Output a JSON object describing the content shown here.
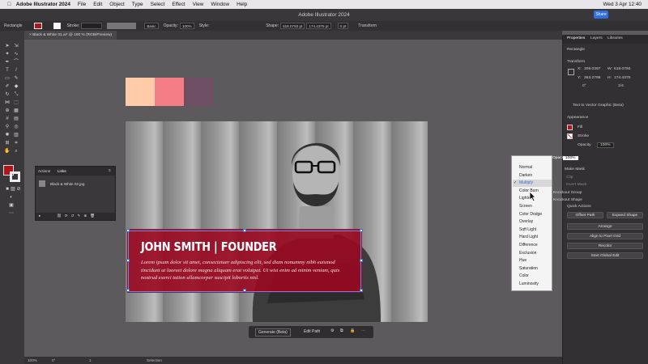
{
  "menubar": {
    "app": "Adobe Illustrator 2024",
    "items": [
      "File",
      "Edit",
      "Object",
      "Type",
      "Select",
      "Effect",
      "View",
      "Window",
      "Help"
    ],
    "share": "Share",
    "datetime": "Wed 3 Apr  12:40"
  },
  "titlebar": {
    "title": "Adobe Illustrator 2024"
  },
  "controlbar": {
    "selection": "Rectangle",
    "stroke_label": "Stroke:",
    "brush": "Basic",
    "opacity_label": "Opacity:",
    "opacity": "100%",
    "style_label": "Style:",
    "shape_label": "Shape:",
    "w": "618.0793 pt",
    "h": "174.4375 pt",
    "corner": "0 pt",
    "transform": "Transform"
  },
  "doc": {
    "tab": "Black & White 01.ai* @ 100 % (RGB/Preview)"
  },
  "swatches": [
    "#ffcba9",
    "#f57d86",
    "#6e4e63"
  ],
  "banner": {
    "title": "JOHN SMITH | FOUNDER",
    "body": "Lorem ipsum dolor sit amet, consectetuer adipiscing elit, sed diam nonummy nibh euismod tincidunt ut laoreet dolore magna aliquam erat volutpat. Ut wisi enim ad minim veniam, quis nostrud exerci tation ullamcorper suscipit lobortis nisl."
  },
  "links": {
    "tab_actions": "Actions",
    "tab_links": "Links",
    "file": "Black & White 02.jpg"
  },
  "props": {
    "tabs": [
      "Properties",
      "Layers",
      "Libraries"
    ],
    "type": "Rectangle",
    "transform": "Transform",
    "x": "309.0397",
    "y": "363.2788",
    "w": "618.0793",
    "h": "174.4375",
    "angle": "0°",
    "ratio": "1/4",
    "text_to_vector": "Text to Vector Graphic (Beta)",
    "appearance": "Appearance",
    "fill": "Fill",
    "stroke": "Stroke",
    "opacity": "Opacity",
    "opacity_val": "100%",
    "blend": "Multiply",
    "opacity2": "Opacity:",
    "opacity2_val": "100%",
    "make_mask": "Make Mask",
    "clip": "Clip",
    "invert": "Invert Mask",
    "knockout": "Knockout Group",
    "knockout_shape": "Knockout Shape",
    "quick_actions": "Quick Actions",
    "offset": "Offset Path",
    "expand": "Expand Shape",
    "arrange": "Arrange",
    "align": "Align to Pixel Grid",
    "recolor": "Recolor",
    "global": "Start Global Edit"
  },
  "blend_modes": [
    "Normal",
    "Darken",
    "Multiply",
    "Color Burn",
    "Lighten",
    "Screen",
    "Color Dodge",
    "Overlay",
    "Soft Light",
    "Hard Light",
    "Difference",
    "Exclusion",
    "Hue",
    "Saturation",
    "Color",
    "Luminosity"
  ],
  "blend_selected": "Multiply",
  "bottombar": {
    "generate": "Generate (Beta)",
    "edit_path": "Edit Path"
  },
  "status": {
    "zoom": "100%",
    "angle": "0°",
    "page": "1",
    "tool": "Selection"
  }
}
